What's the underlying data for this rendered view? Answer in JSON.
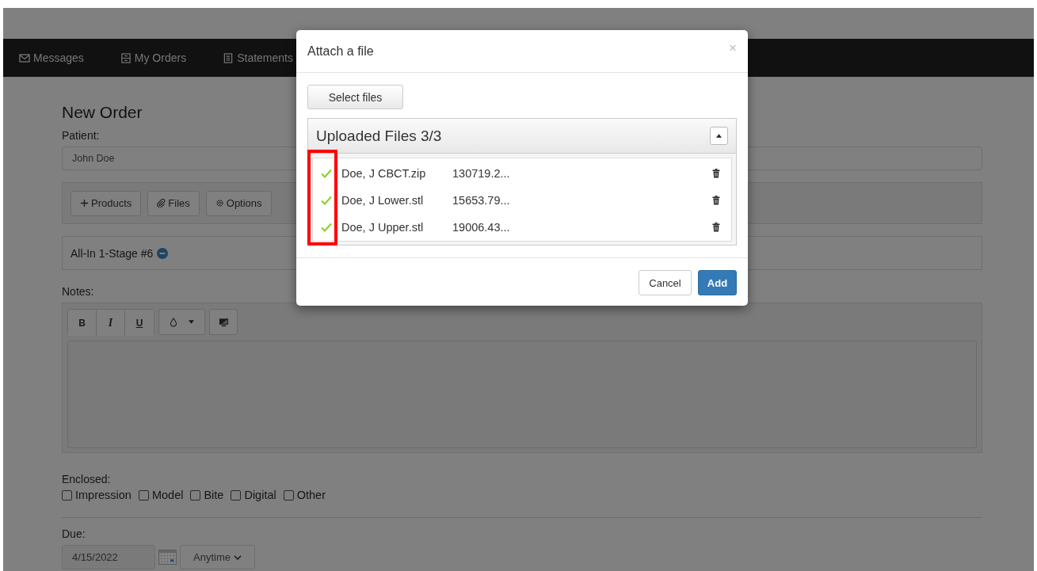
{
  "nav": [
    {
      "label": "Messages"
    },
    {
      "label": "My Orders"
    },
    {
      "label": "Statements"
    }
  ],
  "page": {
    "title": "New Order",
    "patient_label": "Patient:",
    "patient_value": "John Doe",
    "toolbar": [
      {
        "label": "Products"
      },
      {
        "label": "Files"
      },
      {
        "label": "Options"
      }
    ],
    "product": "All-In 1-Stage #6",
    "notes_label": "Notes:",
    "editor_tools": [
      {
        "label": "B",
        "kind": "bold"
      },
      {
        "label": "I",
        "kind": "italic"
      },
      {
        "label": "U",
        "kind": "underline"
      }
    ],
    "enclosed_label": "Enclosed:",
    "enclosed": [
      {
        "label": "Impression",
        "checked": false
      },
      {
        "label": "Model",
        "checked": false
      },
      {
        "label": "Bite",
        "checked": false
      },
      {
        "label": "Digital",
        "checked": false
      },
      {
        "label": "Other",
        "checked": false
      }
    ],
    "due_label": "Due:",
    "due_date": "4/15/2022",
    "due_time": "Anytime"
  },
  "modal": {
    "title": "Attach a file",
    "close": "×",
    "select_button": "Select files",
    "panel_title": "Uploaded Files 3/3",
    "expanded": true,
    "files": [
      {
        "name": "Doe, J CBCT.zip",
        "size": "130719.2...",
        "uploaded": true
      },
      {
        "name": "Doe, J Lower.stl",
        "size": "15653.79...",
        "uploaded": true
      },
      {
        "name": "Doe, J Upper.stl",
        "size": "19006.43...",
        "uploaded": true
      }
    ],
    "cancel": "Cancel",
    "add": "Add"
  }
}
